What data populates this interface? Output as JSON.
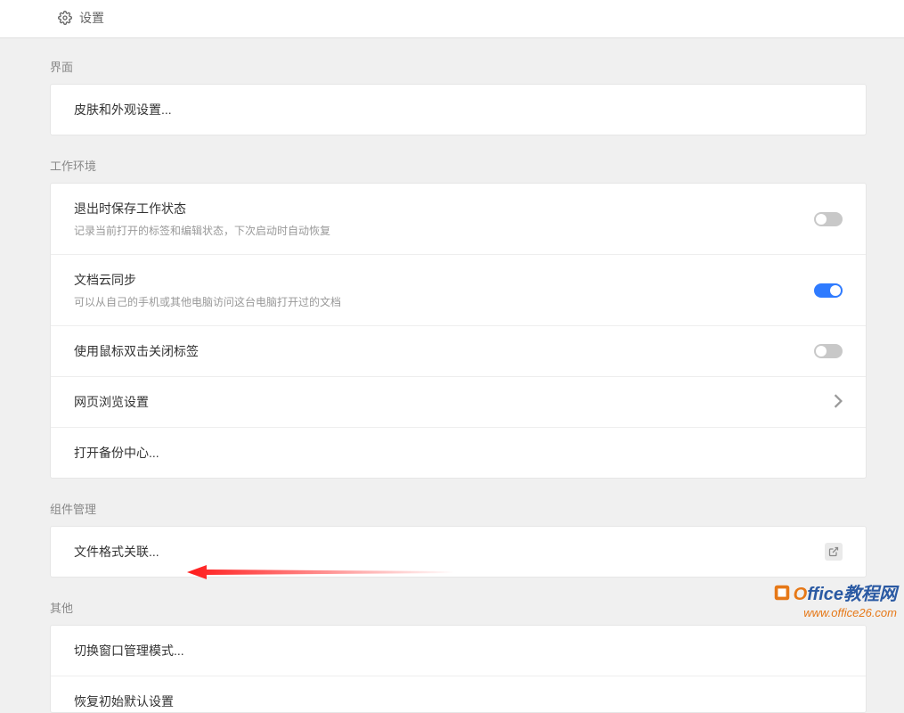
{
  "header": {
    "title": "设置"
  },
  "sections": {
    "interface": {
      "label": "界面",
      "skin": "皮肤和外观设置..."
    },
    "work_env": {
      "label": "工作环境",
      "save_on_exit": {
        "title": "退出时保存工作状态",
        "desc": "记录当前打开的标签和编辑状态，下次启动时自动恢复"
      },
      "cloud_sync": {
        "title": "文档云同步",
        "desc": "可以从自己的手机或其他电脑访问这台电脑打开过的文档"
      },
      "dblclick_close": {
        "title": "使用鼠标双击关闭标签"
      },
      "web_browse": {
        "title": "网页浏览设置"
      },
      "backup_center": {
        "title": "打开备份中心..."
      }
    },
    "component": {
      "label": "组件管理",
      "file_assoc": "文件格式关联..."
    },
    "other": {
      "label": "其他",
      "window_mode": "切换窗口管理模式...",
      "restore_default": "恢复初始默认设置"
    }
  },
  "watermark": {
    "brand_o": "O",
    "brand_rest": "ffice教程网",
    "url": "www.office26.com"
  }
}
